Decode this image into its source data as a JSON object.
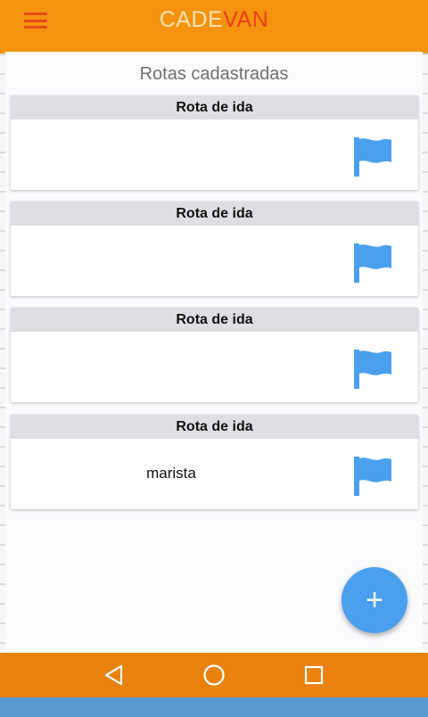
{
  "app": {
    "brand_part1": "CADE",
    "brand_part2": "VAN"
  },
  "page": {
    "title": "Rotas cadastradas"
  },
  "routes": [
    {
      "header": "Rota de ida",
      "name": ""
    },
    {
      "header": "Rota de ida",
      "name": ""
    },
    {
      "header": "Rota de ida",
      "name": ""
    },
    {
      "header": "Rota de ida",
      "name": "marista"
    }
  ],
  "fab": {
    "label": "+"
  },
  "colors": {
    "app_bar": "#f5930e",
    "brand_light": "#fde3b4",
    "brand_accent": "#e8401b",
    "flag": "#4aa0ee",
    "fab": "#4aa0ee",
    "nav_bar": "#e8820c"
  },
  "icons": {
    "menu": "menu-icon",
    "route_flag": "flag-icon",
    "nav_back": "back-triangle-icon",
    "nav_home": "home-circle-icon",
    "nav_recents": "recents-square-icon"
  }
}
